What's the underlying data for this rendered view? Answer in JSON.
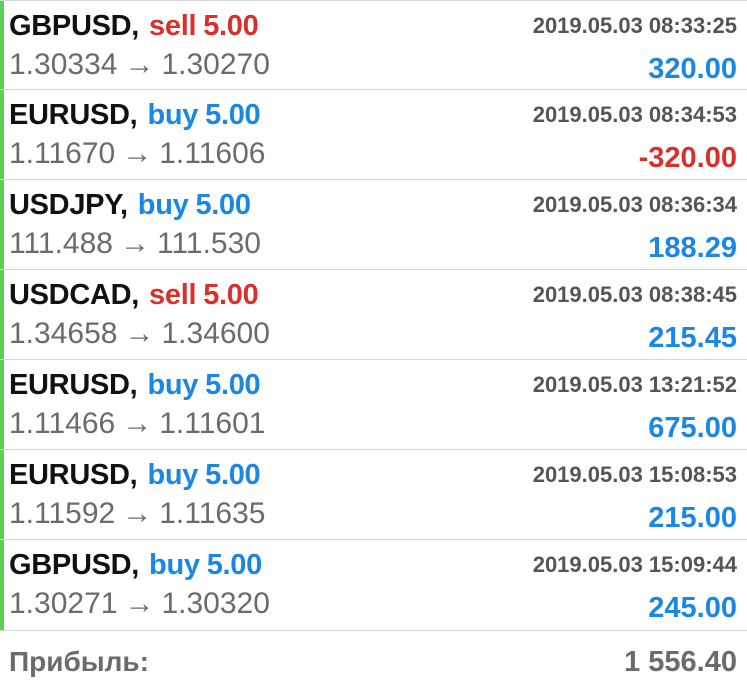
{
  "colors": {
    "sell": "#d9302c",
    "buy": "#1a86e6",
    "profit_positive": "#1a86e6",
    "profit_negative": "#d9302c",
    "row_accent": "#5ccf5a"
  },
  "trades": [
    {
      "symbol": "GBPUSD",
      "comma": ",",
      "side": "sell",
      "volume": "5.00",
      "time": "2019.05.03 08:33:25",
      "open_price": "1.30334",
      "arrow": "→",
      "close_price": "1.30270",
      "profit": "320.00"
    },
    {
      "symbol": "EURUSD",
      "comma": ",",
      "side": "buy",
      "volume": "5.00",
      "time": "2019.05.03 08:34:53",
      "open_price": "1.11670",
      "arrow": "→",
      "close_price": "1.11606",
      "profit": "-320.00"
    },
    {
      "symbol": "USDJPY",
      "comma": ",",
      "side": "buy",
      "volume": "5.00",
      "time": "2019.05.03 08:36:34",
      "open_price": "111.488",
      "arrow": "→",
      "close_price": "111.530",
      "profit": "188.29"
    },
    {
      "symbol": "USDCAD",
      "comma": ",",
      "side": "sell",
      "volume": "5.00",
      "time": "2019.05.03 08:38:45",
      "open_price": "1.34658",
      "arrow": "→",
      "close_price": "1.34600",
      "profit": "215.45"
    },
    {
      "symbol": "EURUSD",
      "comma": ",",
      "side": "buy",
      "volume": "5.00",
      "time": "2019.05.03 13:21:52",
      "open_price": "1.11466",
      "arrow": "→",
      "close_price": "1.11601",
      "profit": "675.00"
    },
    {
      "symbol": "EURUSD",
      "comma": ",",
      "side": "buy",
      "volume": "5.00",
      "time": "2019.05.03 15:08:53",
      "open_price": "1.11592",
      "arrow": "→",
      "close_price": "1.11635",
      "profit": "215.00"
    },
    {
      "symbol": "GBPUSD",
      "comma": ",",
      "side": "buy",
      "volume": "5.00",
      "time": "2019.05.03 15:09:44",
      "open_price": "1.30271",
      "arrow": "→",
      "close_price": "1.30320",
      "profit": "245.00"
    }
  ],
  "summary": {
    "label": "Прибыль:",
    "value": "1 556.40"
  }
}
